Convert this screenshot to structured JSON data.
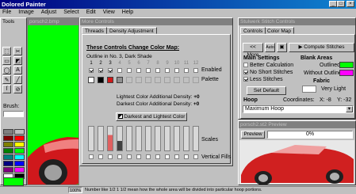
{
  "window": {
    "title": "Dolored Painter"
  },
  "menu": [
    "File",
    "Image",
    "Adjust",
    "Select",
    "Edit",
    "View",
    "Help"
  ],
  "tools": {
    "title": "Tools",
    "brush_label": "Brush:",
    "palette": [
      "#808080",
      "#c0c0c0",
      "#800000",
      "#ff0000",
      "#808000",
      "#ffff00",
      "#008000",
      "#00ff00",
      "#008080",
      "#00ffff",
      "#000080",
      "#0000ff",
      "#800080",
      "#ff00ff",
      "#ffffff",
      "#000000"
    ]
  },
  "image_window": {
    "title": "porsch2.bmp",
    "bg": "#00ff00"
  },
  "more_controls": {
    "title": "More Controls",
    "tabs": [
      "Threads",
      "Density Adjustment"
    ],
    "heading": "These Controls Change Color Map:",
    "outline": "Outline in No. 3, Dark Shade",
    "numbers": [
      "1",
      "2",
      "3",
      "4",
      "5",
      "6",
      "7",
      "8",
      "9",
      "10",
      "11",
      "12"
    ],
    "enabled_label": "Enabled",
    "palette_label": "Palette",
    "lightest_label": "Lightest Color Additional Density:",
    "lightest_value": "+0",
    "darkest_label": "Darkest Color Additional Density:",
    "darkest_value": "+0",
    "dl_button": "Darkest and Lightest Color",
    "scales_label": "Scales",
    "vfills_label": "Vertical Fills"
  },
  "stitch": {
    "title": "Stulwerk Stitch Controls",
    "tabs": [
      "Controls",
      "Color Map"
    ],
    "more_btn": "<< More",
    "auto_btn": "Auto",
    "compute_btn": "Compute Stitches",
    "main_settings": "Main Settings",
    "better_calc": "Better Calculation",
    "no_short": "No Short Stitches",
    "less_stitches": "Less Stitches",
    "set_default": "Set Default",
    "blank_areas": "Blank Areas",
    "outlined": "Outlined:",
    "without_outline": "Without Outline:",
    "fabric": "Fabric",
    "fabric_value": "Very Light",
    "hoop": "Hoop",
    "coordinates": "Coordinates:",
    "x": "X: -8",
    "y": "Y: -32",
    "hoop_select": "Maximum Hoop",
    "outlined_color": "#00ff00",
    "without_color": "#ff00ff"
  },
  "preview": {
    "title": "porsch2.st2 Preview",
    "button": "Preview",
    "percent": "0%",
    "progress": 0
  },
  "status": {
    "zoom": "100%",
    "text": "Number like 1/2 1 1/2 mean how the whole area will be divided into particular hoop portions."
  }
}
